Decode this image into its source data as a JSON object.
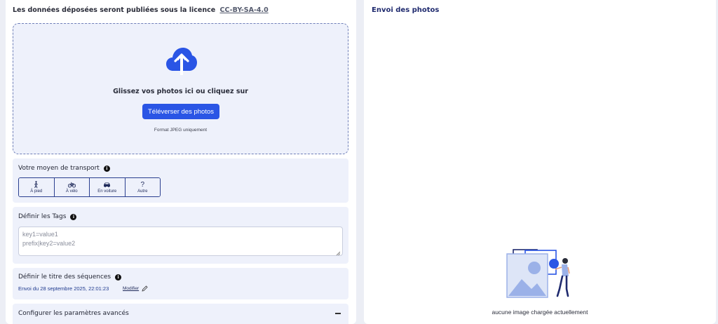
{
  "license": {
    "text": "Les données déposées seront publiées sous la licence",
    "link": "CC-BY-SA-4.0"
  },
  "dropzone": {
    "icon": "cloud-upload-icon",
    "text": "Glissez vos photos ici ou cliquez sur",
    "button_label": "Téléverser des photos",
    "format_note": "Format JPEG uniquement"
  },
  "transport": {
    "title": "Votre moyen de transport",
    "options": [
      {
        "label": "À pied",
        "icon": "walking-icon"
      },
      {
        "label": "À vélo",
        "icon": "bicycle-icon"
      },
      {
        "label": "En voiture",
        "icon": "car-icon"
      },
      {
        "label": "Autre",
        "icon": "question-icon",
        "glyph": "?"
      }
    ]
  },
  "tags": {
    "title": "Définir les Tags",
    "placeholder": "key1=value1\nprefix|key2=value2"
  },
  "sequence": {
    "title": "Définir le titre des séquences",
    "value": "Envoi du 28 septembre 2025, 22:01:23",
    "modify_label": "Modifier"
  },
  "advanced": {
    "title": "Configurer les paramètres avancés"
  },
  "upload_panel": {
    "title": "Envoi des photos",
    "empty_text": "aucune image chargée actuellement"
  },
  "colors": {
    "accent": "#2a55e5",
    "navy": "#1f2a6e",
    "panel_bg": "#eef1fb"
  }
}
